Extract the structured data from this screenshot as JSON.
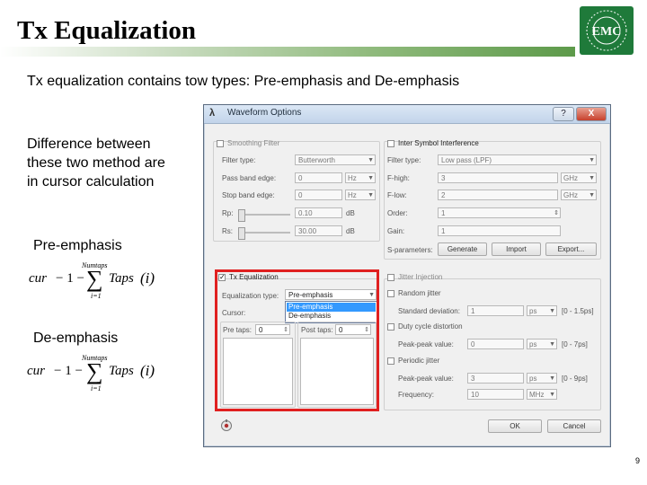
{
  "slide": {
    "title": "Tx Equalization",
    "intro": "Tx equalization contains tow types: Pre-emphasis and De-emphasis",
    "difference_lines": [
      "Difference between",
      "these two method are",
      "in cursor calculation"
    ],
    "pre_label": "Pre-emphasis",
    "de_label": "De-emphasis",
    "formula": {
      "lhs": "cur",
      "minus1": "− 1 −",
      "sum": "∑",
      "sum_top": "Numtaps",
      "sum_bottom": "i=1",
      "term": "Taps",
      "index": "(i)"
    },
    "logo_text": "EMC",
    "page_number": "9"
  },
  "dialog": {
    "title": "Waveform Options",
    "help_button": "?",
    "close_button": "X",
    "smoothing": {
      "label": "Smoothing Filter",
      "filter_type_label": "Filter type:",
      "filter_type_value": "Butterworth",
      "passband_label": "Pass band edge:",
      "passband_value": "0",
      "passband_unit": "Hz",
      "stopband_label": "Stop band edge:",
      "stopband_value": "0",
      "stopband_unit": "Hz",
      "rp_label": "Rp:",
      "rp_value": "0.10",
      "rp_unit": "dB",
      "rs_label": "Rs:",
      "rs_value": "30.00",
      "rs_unit": "dB"
    },
    "isi": {
      "label": "Inter Symbol Interference",
      "filter_type_label": "Filter type:",
      "filter_type_value": "Low pass (LPF)",
      "fhigh_label": "F-high:",
      "fhigh_value": "3",
      "fhigh_unit": "GHz",
      "flow_label": "F-low:",
      "flow_value": "2",
      "flow_unit": "GHz",
      "order_label": "Order:",
      "order_value": "1",
      "gain_label": "Gain:",
      "gain_value": "1",
      "sparams_label": "S-parameters:",
      "generate": "Generate",
      "import": "Import",
      "export": "Export..."
    },
    "tx_eq": {
      "checked": true,
      "label": "Tx Equalization",
      "type_label": "Equalization type:",
      "type_value": "Pre-emphasis",
      "options": [
        "Pre-emphasis",
        "De-emphasis"
      ],
      "cursor_label": "Cursor:",
      "pre_taps_label": "Pre taps:",
      "pre_taps_value": "0",
      "post_taps_label": "Post taps:",
      "post_taps_value": "0"
    },
    "jitter": {
      "label": "Jitter Injection",
      "random_label": "Random jitter",
      "std_dev_label": "Standard deviation:",
      "std_dev_value": "1",
      "std_dev_unit": "ps",
      "std_dev_range": "[0 - 1.5ps]",
      "duty_label": "Duty cycle distortion",
      "dcd_pp_label": "Peak-peak value:",
      "dcd_pp_value": "0",
      "dcd_pp_unit": "ps",
      "dcd_pp_range": "[0 - 7ps]",
      "periodic_label": "Periodic jitter",
      "pj_pp_label": "Peak-peak value:",
      "pj_pp_value": "3",
      "pj_pp_unit": "ps",
      "pj_pp_range": "[0 - 9ps]",
      "freq_label": "Frequency:",
      "freq_value": "10",
      "freq_unit": "MHz"
    },
    "ok_button": "OK",
    "cancel_button": "Cancel"
  },
  "colors": {
    "highlight_frame": "#e02020",
    "selected_option": "#3399ff",
    "title_gradient_end": "#5d9a4a",
    "logo_green": "#1f7a3a"
  }
}
